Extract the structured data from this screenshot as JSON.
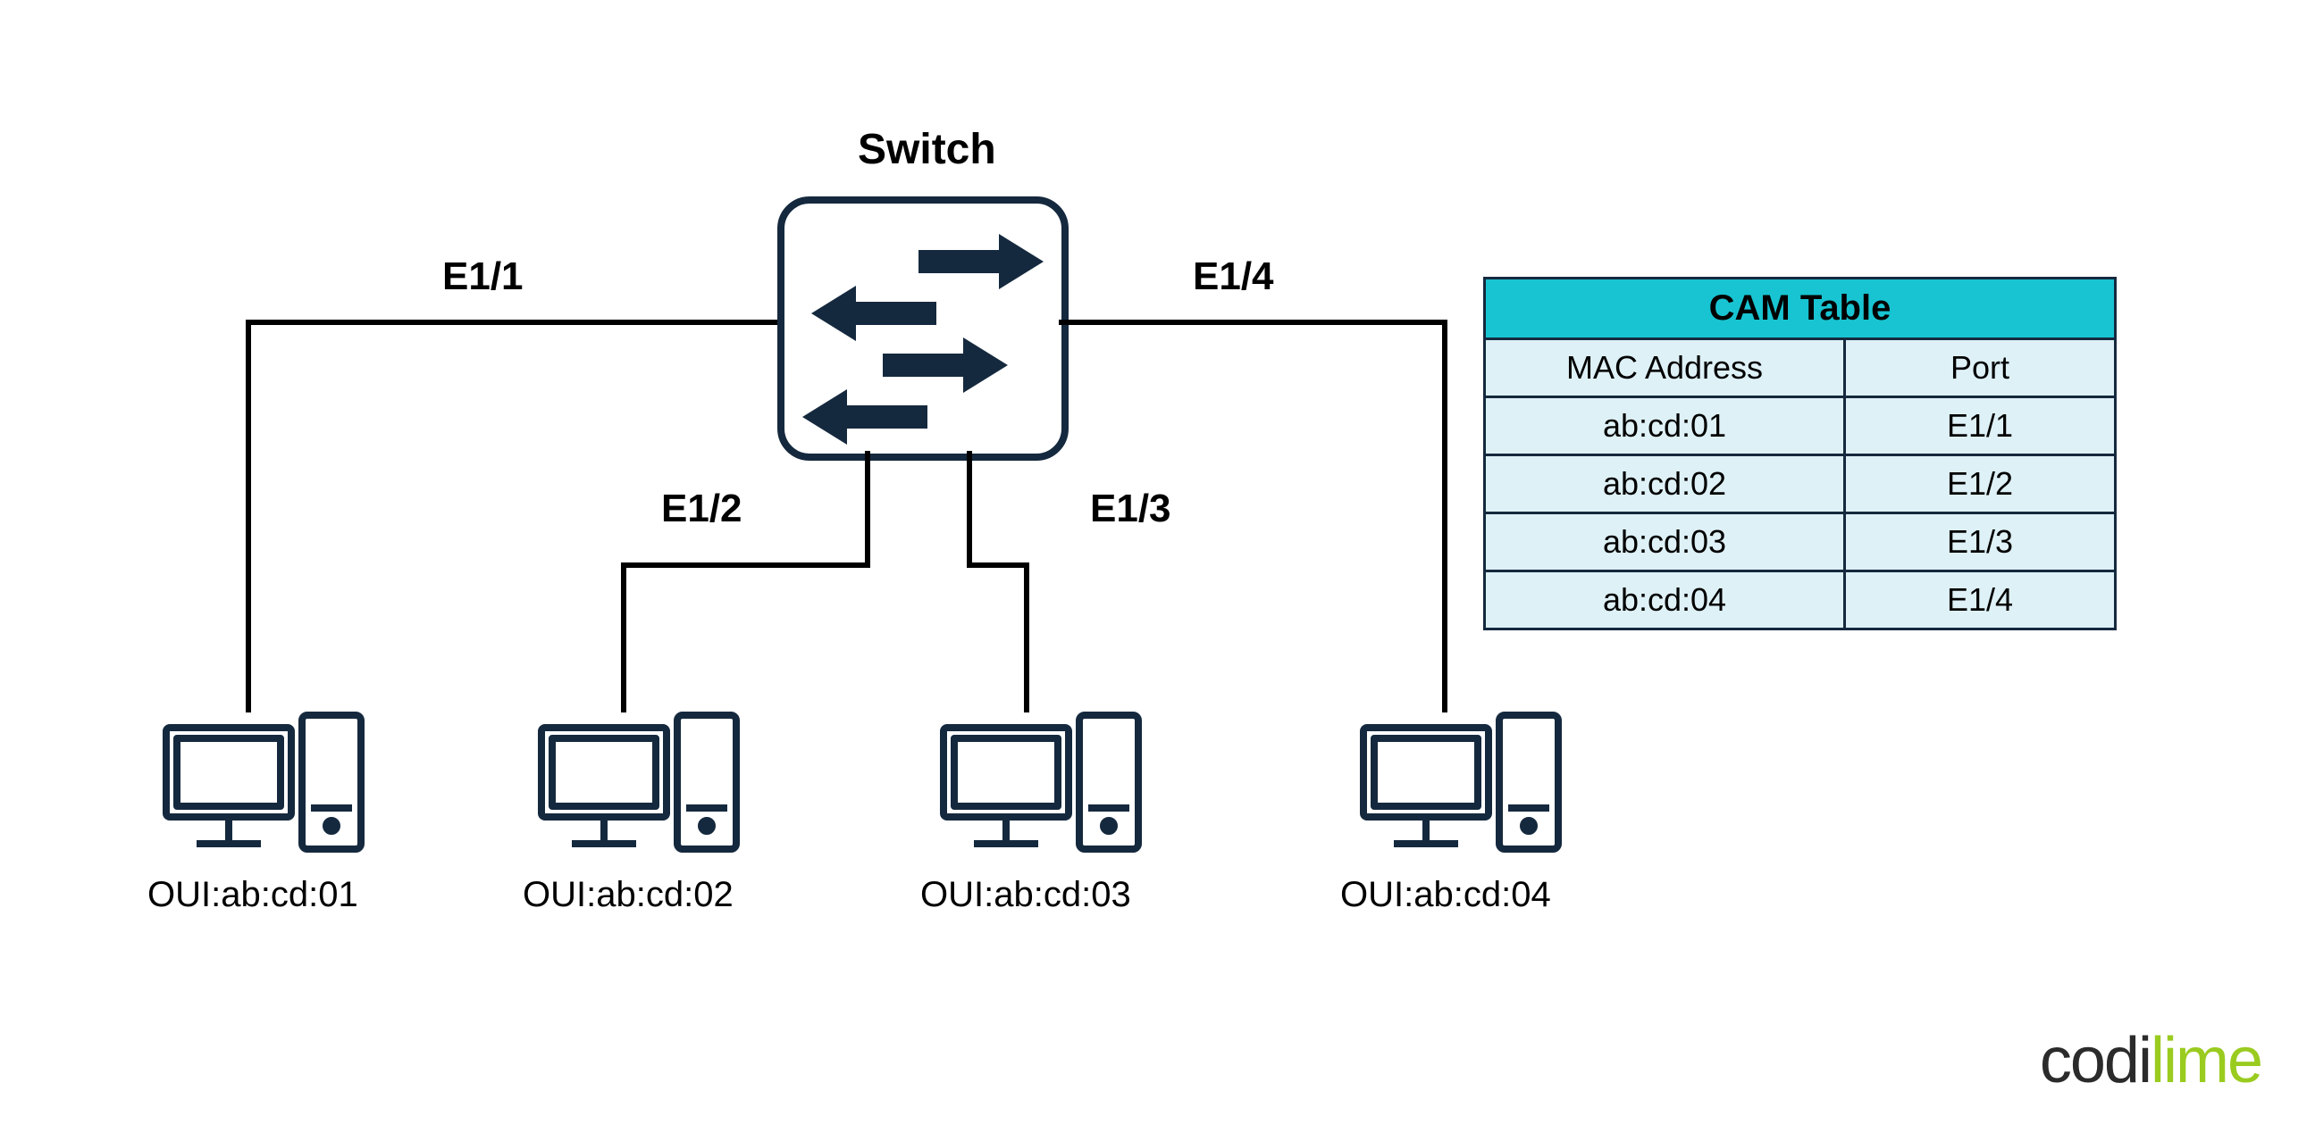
{
  "switch_title": "Switch",
  "ports": {
    "p1": "E1/1",
    "p2": "E1/2",
    "p3": "E1/3",
    "p4": "E1/4"
  },
  "hosts": {
    "h1": "OUI:ab:cd:01",
    "h2": "OUI:ab:cd:02",
    "h3": "OUI:ab:cd:03",
    "h4": "OUI:ab:cd:04"
  },
  "cam_table": {
    "title": "CAM Table",
    "columns": {
      "mac": "MAC Address",
      "port": "Port"
    },
    "rows": [
      {
        "mac": "ab:cd:01",
        "port": "E1/1"
      },
      {
        "mac": "ab:cd:02",
        "port": "E1/2"
      },
      {
        "mac": "ab:cd:03",
        "port": "E1/3"
      },
      {
        "mac": "ab:cd:04",
        "port": "E1/4"
      }
    ]
  },
  "logo": {
    "part1": "codi",
    "part2": "lime"
  },
  "chart_data": {
    "type": "table",
    "title": "CAM Table",
    "columns": [
      "MAC Address",
      "Port"
    ],
    "rows": [
      [
        "ab:cd:01",
        "E1/1"
      ],
      [
        "ab:cd:02",
        "E1/2"
      ],
      [
        "ab:cd:03",
        "E1/3"
      ],
      [
        "ab:cd:04",
        "E1/4"
      ]
    ]
  }
}
